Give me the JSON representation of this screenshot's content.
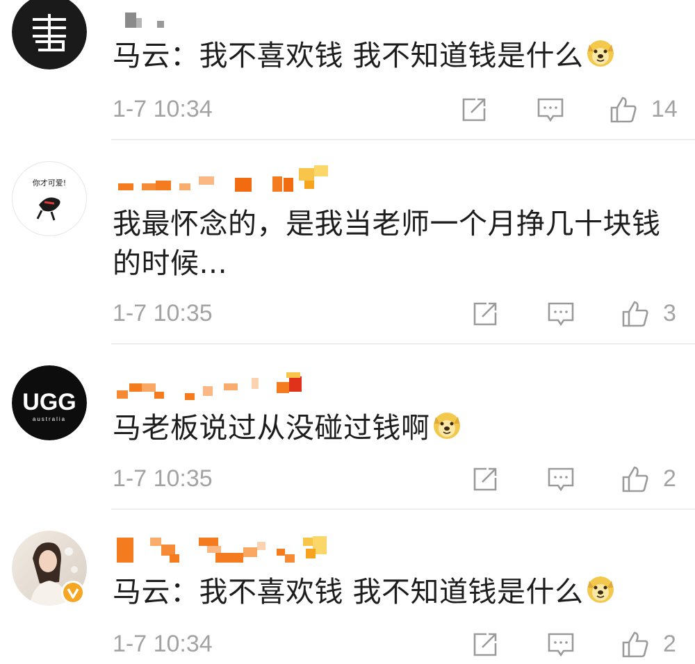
{
  "comments": [
    {
      "text": "马云：我不喜欢钱 我不知道钱是什么",
      "timestamp": "1-7 10:34",
      "likes": "14",
      "avatar_icon": "newspaper-logo-icon",
      "verified": false
    },
    {
      "text": "我最怀念的，是我当老师一个月挣几十块钱的时候...",
      "timestamp": "1-7 10:35",
      "likes": "3",
      "avatar_icon": "cartoon-avatar-icon",
      "avatar_text": "你才可爱!",
      "verified": false
    },
    {
      "text": "马老板说过从没碰过钱啊",
      "timestamp": "1-7 10:35",
      "likes": "2",
      "avatar_icon": "ugg-logo-icon",
      "avatar_text": "UGG",
      "avatar_subtext": "australia",
      "verified": false
    },
    {
      "text": "马云：我不喜欢钱 我不知道钱是什么",
      "timestamp": "1-7 10:34",
      "likes": "2",
      "avatar_icon": "photo-avatar-icon",
      "verified": true
    }
  ],
  "icons": {
    "repost": "repost-icon",
    "reply": "comment-icon",
    "like": "thumbs-up-icon",
    "emoji": "doge-emoji-icon"
  },
  "colors": {
    "timestamp": "#a3a3a3",
    "text": "#1d1d1d",
    "mosaic_orange": "#f57c1e",
    "verified_badge": "#f5a623"
  }
}
